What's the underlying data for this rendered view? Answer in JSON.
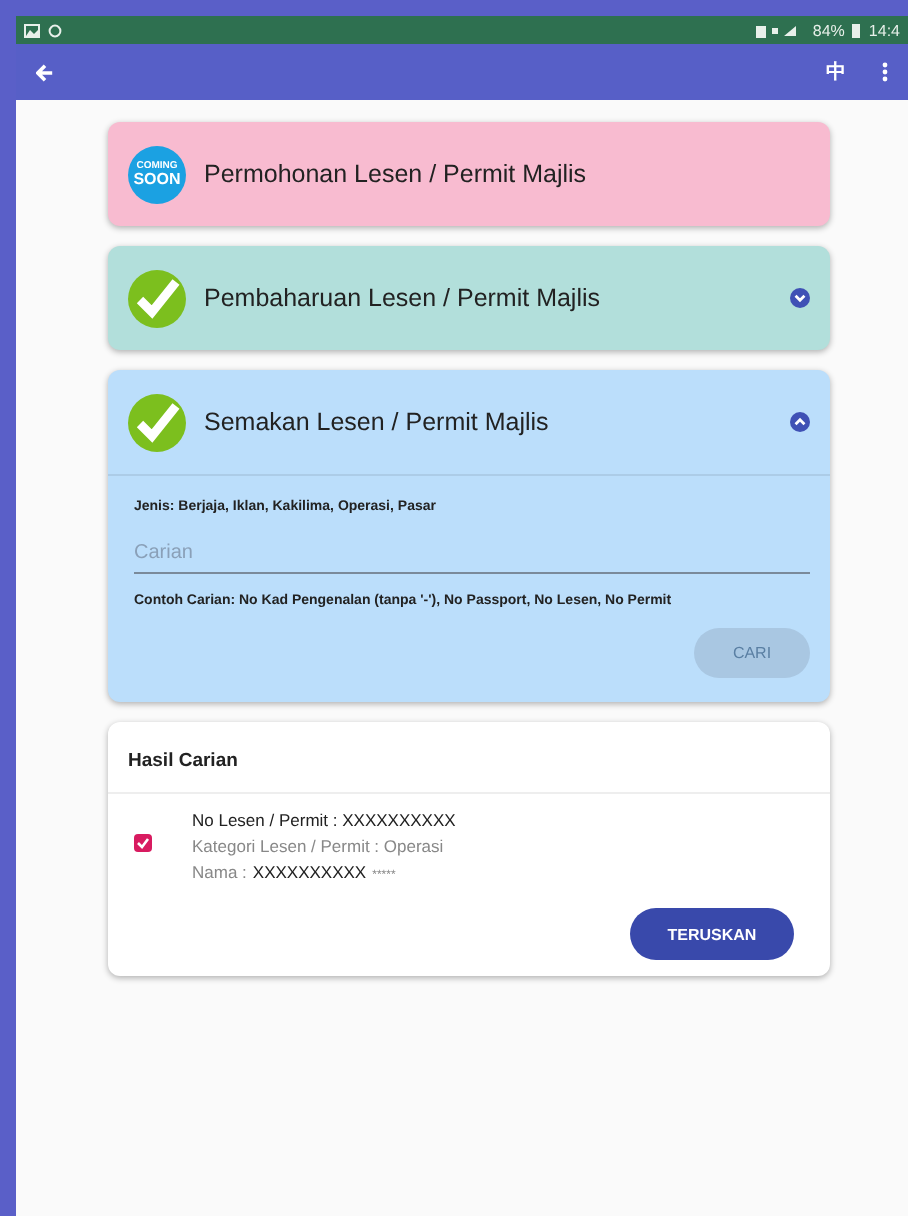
{
  "status_bar": {
    "battery": "84%",
    "time": "14:4"
  },
  "app_bar": {
    "language": "中"
  },
  "panels": [
    {
      "title": "Permohonan Lesen / Permit Majlis",
      "color": "#f8bbd0",
      "kind": "coming_soon",
      "badge_text": [
        "COMING",
        "SOON"
      ]
    },
    {
      "title": "Pembaharuan Lesen / Permit Majlis",
      "color": "#b2dfdb",
      "kind": "check",
      "expanded": false
    },
    {
      "title": "Semakan Lesen / Permit Majlis",
      "color": "#bbdefb",
      "kind": "check",
      "expanded": true
    }
  ],
  "search": {
    "types": "Jenis: Berjaja, Iklan, Kakilima, Operasi, Pasar",
    "placeholder": "Carian",
    "hint": "Contoh Carian: No Kad Pengenalan (tanpa '-'), No Passport, No Lesen, No Permit",
    "button": "CARI",
    "button_disabled": true
  },
  "results": {
    "title": "Hasil Carian",
    "items": [
      {
        "checked": true,
        "license": "No Lesen / Permit : XXXXXXXXXX",
        "category": "Kategori Lesen / Permit : Operasi",
        "name_label": "Nama :",
        "name_value": "XXXXXXXXXX",
        "name_mask": "*****"
      }
    ],
    "button": "TERUSKAN"
  }
}
